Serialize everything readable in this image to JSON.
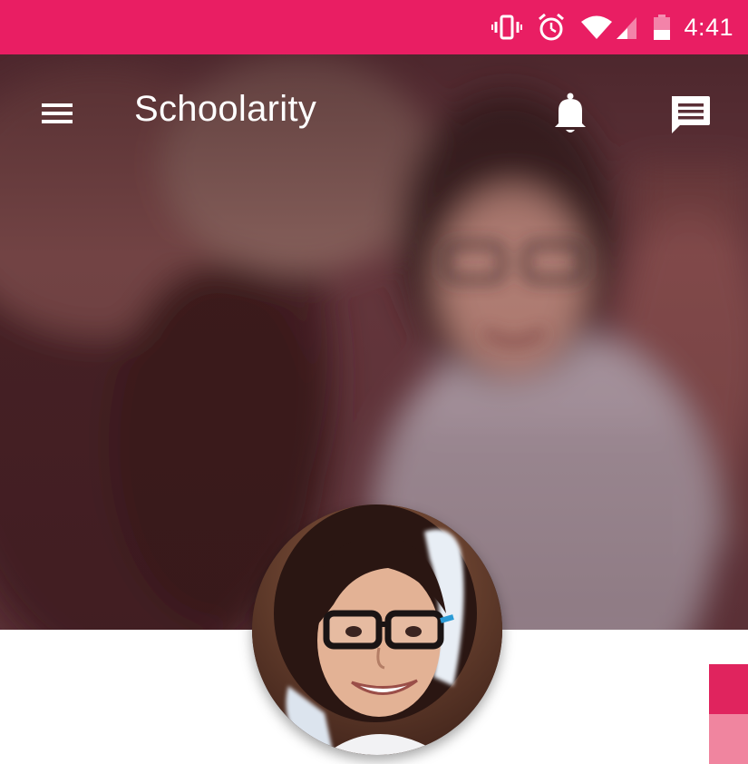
{
  "status_bar": {
    "time": "4:41",
    "icons": [
      "vibrate-icon",
      "alarm-icon",
      "wifi-icon",
      "signal-icon",
      "battery-icon"
    ],
    "color": "#e91e63"
  },
  "toolbar": {
    "title": "Schoolarity",
    "icons": [
      "menu-icon",
      "bell-icon",
      "chat-icon"
    ]
  },
  "hero": {
    "image": "blurred-student-photo"
  },
  "profile": {
    "avatar": "student-avatar-photo"
  },
  "colors": {
    "accent": "#e91e63",
    "card_top": "#e0245e",
    "card_bottom": "#f0859f",
    "hero_tint": "#5a2e35"
  }
}
